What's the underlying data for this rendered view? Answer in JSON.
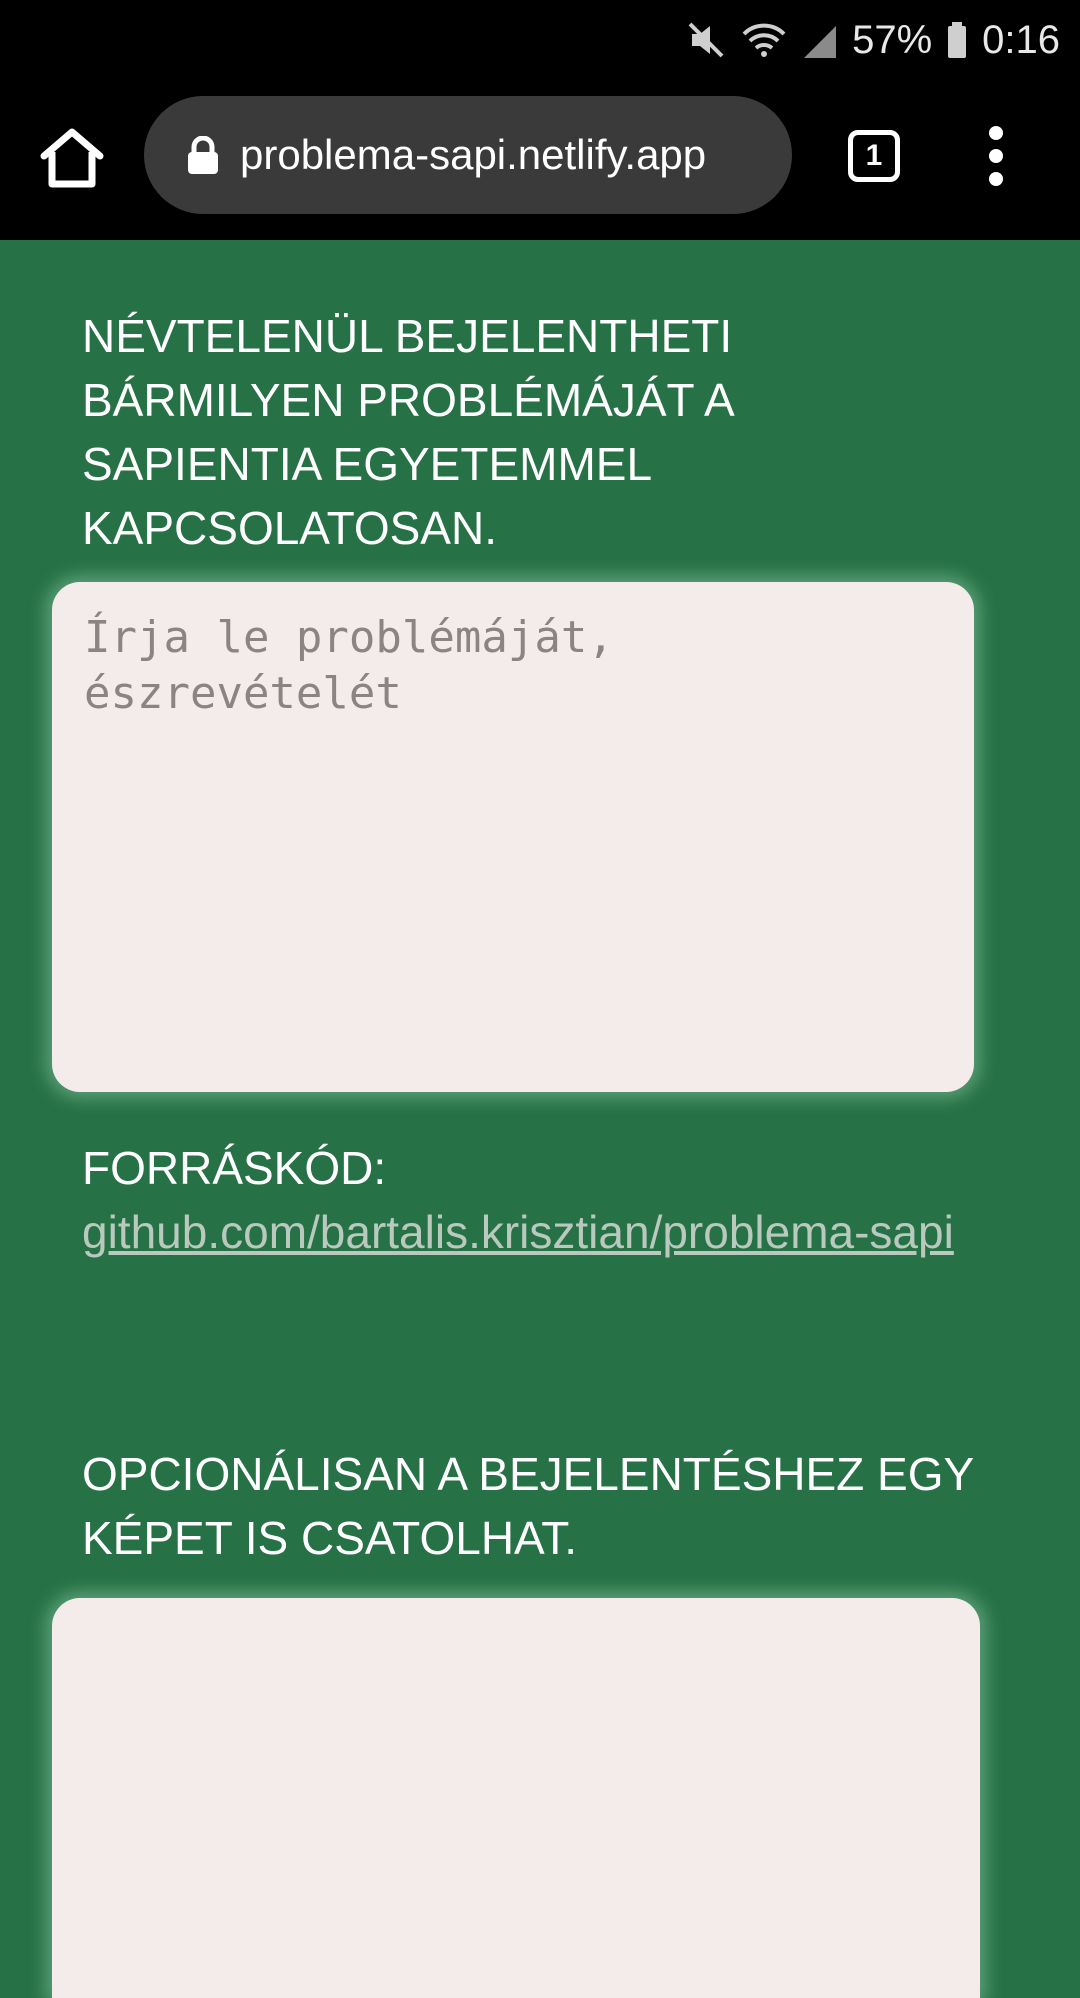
{
  "status_bar": {
    "battery_percent": "57%",
    "time": "0:16",
    "icons": [
      "mute-icon",
      "wifi-icon",
      "signal-icon",
      "battery-icon"
    ]
  },
  "browser": {
    "url": "problema-sapi.netlify.app",
    "tab_count": "1",
    "icons": [
      "home-icon",
      "lock-icon",
      "tabs-icon",
      "more-vert-icon"
    ]
  },
  "page": {
    "intro_heading": "NÉVTELENÜL BEJELENTHETI BÁRMILYEN PROBLÉMÁJÁT A SAPIENTIA EGYETEMMEL KAPCSOLATOSAN.",
    "problem_input": {
      "placeholder": "Írja le problémáját, észrevételét",
      "value": ""
    },
    "source_label": "FORRÁSKÓD:",
    "source_link": "github.com/bartalis.krisztian/problema-sapi",
    "image_heading": "OPCIONÁLISAN A BEJELENTÉSHEZ EGY KÉPET IS CSATOLHAT."
  },
  "colors": {
    "background": "#267146",
    "card": "#f4ecea",
    "link": "#b9c9be",
    "browser_bar": "#000000",
    "url_pill": "#3a3a3a"
  }
}
